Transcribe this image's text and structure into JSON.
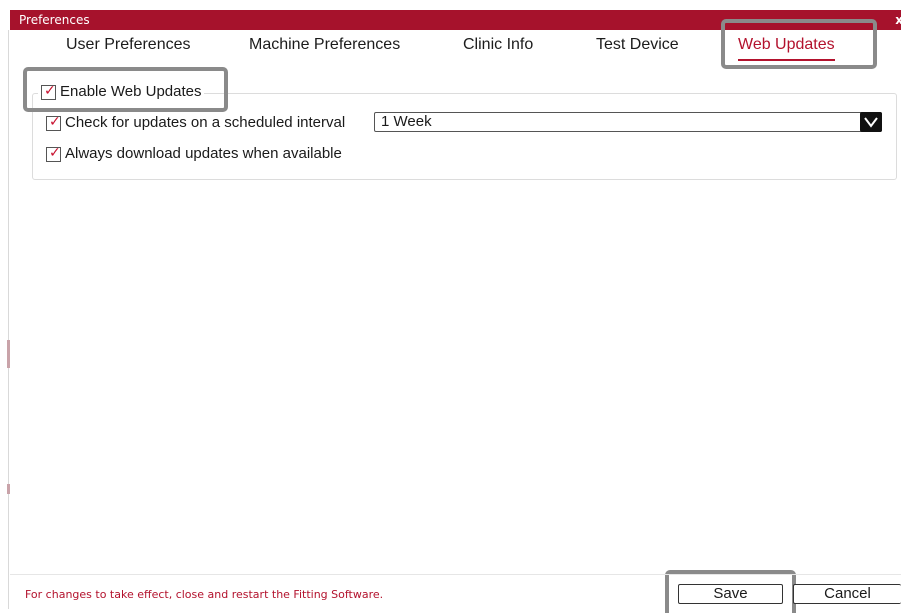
{
  "window": {
    "title": "Preferences",
    "close_glyph": "x"
  },
  "tabs": [
    {
      "label": "User Preferences",
      "active": false
    },
    {
      "label": "Machine Preferences",
      "active": false
    },
    {
      "label": "Clinic Info",
      "active": false
    },
    {
      "label": "Test Device",
      "active": false
    },
    {
      "label": "Web Updates",
      "active": true
    }
  ],
  "web_updates": {
    "enable_label": "Enable Web Updates",
    "enable_checked": true,
    "scheduled_label": "Check for updates on a scheduled interval",
    "scheduled_checked": true,
    "interval_value": "1 Week",
    "always_label": "Always download updates when available",
    "always_checked": true
  },
  "footer": {
    "message": "For changes to take effect, close and restart the Fitting Software.",
    "save_label": "Save",
    "cancel_label": "Cancel"
  },
  "icons": {
    "check": "checkmark-icon",
    "dropdown": "chevron-down-icon",
    "close": "close-icon"
  },
  "colors": {
    "accent": "#a6122c",
    "highlight_box": "#8a8a8a"
  }
}
